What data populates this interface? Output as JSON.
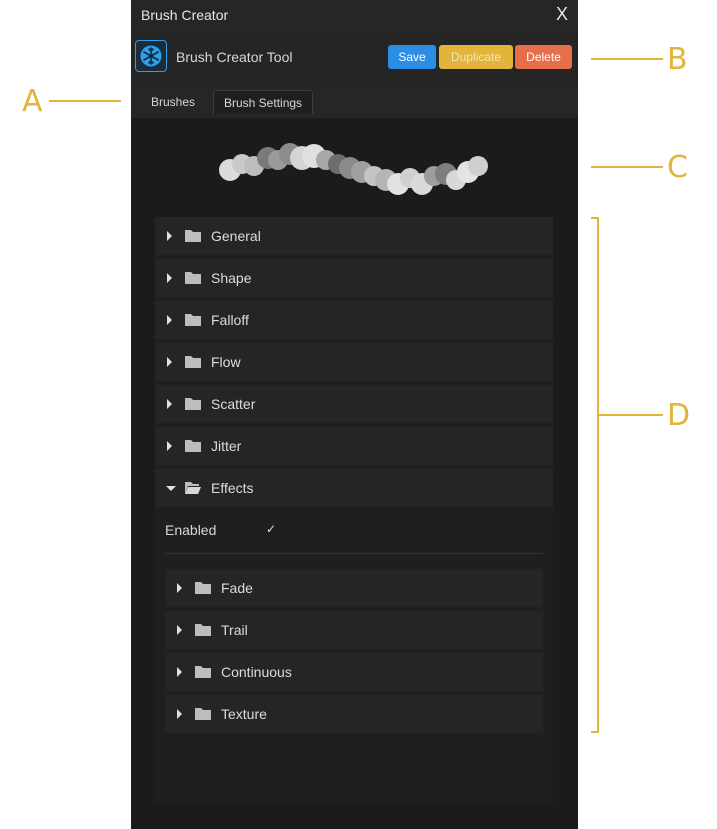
{
  "window": {
    "title": "Brush Creator",
    "close_label": "X"
  },
  "toolbar": {
    "tool_name": "Brush Creator Tool",
    "tool_icon": "snowflake-icon",
    "save_label": "Save",
    "duplicate_label": "Duplicate",
    "delete_label": "Delete"
  },
  "tabs": [
    {
      "label": "Brushes",
      "active": false
    },
    {
      "label": "Brush Settings",
      "active": true
    }
  ],
  "sections": [
    {
      "label": "General",
      "expanded": false
    },
    {
      "label": "Shape",
      "expanded": false
    },
    {
      "label": "Falloff",
      "expanded": false
    },
    {
      "label": "Flow",
      "expanded": false
    },
    {
      "label": "Scatter",
      "expanded": false
    },
    {
      "label": "Jitter",
      "expanded": false
    },
    {
      "label": "Effects",
      "expanded": true
    }
  ],
  "effects": {
    "enabled_label": "Enabled",
    "enabled_check": "✓",
    "subsections": [
      {
        "label": "Fade"
      },
      {
        "label": "Trail"
      },
      {
        "label": "Continuous"
      },
      {
        "label": "Texture"
      }
    ]
  },
  "callouts": {
    "a": "A",
    "b": "B",
    "c": "C",
    "d": "D"
  },
  "colors": {
    "accent_blue": "#2b8de6",
    "duplicate_yellow": "#e2b43a",
    "delete_orange": "#e66e4b",
    "callout": "#e2b43a",
    "panel_bg": "#1b1b1b"
  }
}
